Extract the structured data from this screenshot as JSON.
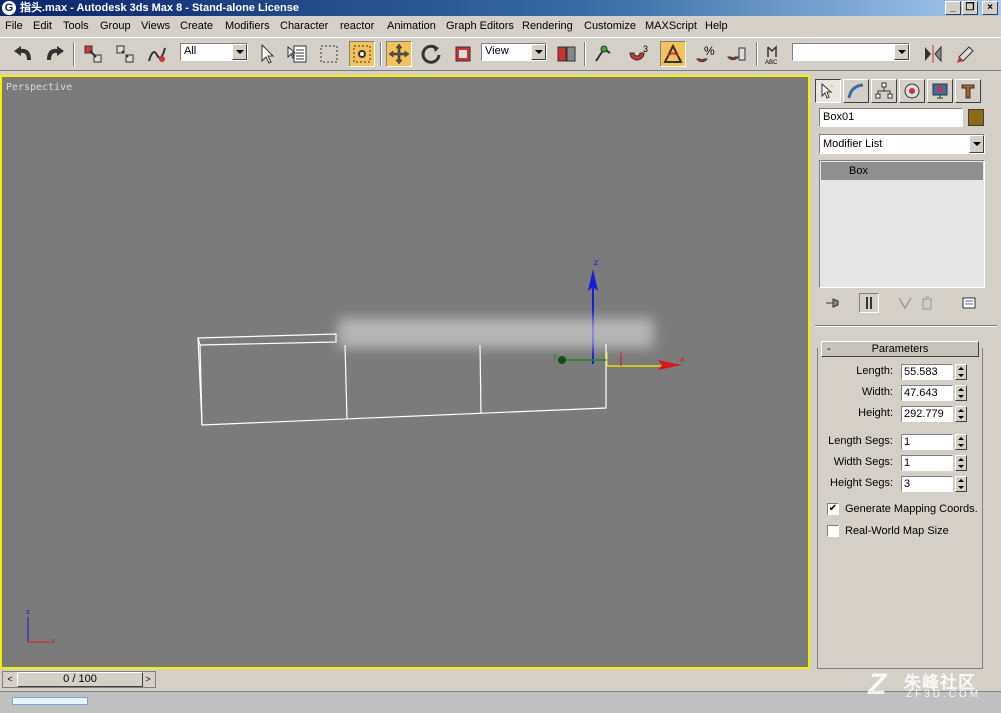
{
  "window": {
    "title": "指头.max - Autodesk 3ds Max 8  - Stand-alone License",
    "app_icon": "3ds-max-logo-icon"
  },
  "menu": [
    "File",
    "Edit",
    "Tools",
    "Group",
    "Views",
    "Create",
    "Modifiers",
    "Character",
    "reactor",
    "Animation",
    "Graph Editors",
    "Rendering",
    "Customize",
    "MAXScript",
    "Help"
  ],
  "toolbar": {
    "selection_filter": "All",
    "reference_coord": "View",
    "named_selection": ""
  },
  "viewport": {
    "label": "Perspective",
    "gizmo_axes": {
      "x": "x",
      "y": "y",
      "z": "z"
    },
    "corner_axes": {
      "x": "x",
      "z": "z"
    },
    "border_color": "#f5f000",
    "background_color": "#7b7b7b"
  },
  "command_panel": {
    "object_name": "Box01",
    "object_color": "#8a6a14",
    "modifier_list_label": "Modifier List",
    "stack_item": "Box",
    "rollout_title": "Parameters",
    "rollout_toggle": "-",
    "params": {
      "length": {
        "label": "Length:",
        "value": "55.583"
      },
      "width": {
        "label": "Width:",
        "value": "47.643"
      },
      "height": {
        "label": "Height:",
        "value": "292.779"
      },
      "length_segs": {
        "label": "Length Segs:",
        "value": "1"
      },
      "width_segs": {
        "label": "Width Segs:",
        "value": "1"
      },
      "height_segs": {
        "label": "Height Segs:",
        "value": "3"
      }
    },
    "checkboxes": {
      "gen_mapping": {
        "label": "Generate Mapping Coords.",
        "checked": true,
        "mark": "✔"
      },
      "real_world": {
        "label": "Real-World Map Size",
        "checked": false,
        "mark": ""
      }
    }
  },
  "time_slider": {
    "label": "0 / 100",
    "prev_glyph": "<",
    "next_glyph": ">"
  },
  "watermark": {
    "text": "朱峰社区",
    "sub": "ZF3D.COM"
  }
}
